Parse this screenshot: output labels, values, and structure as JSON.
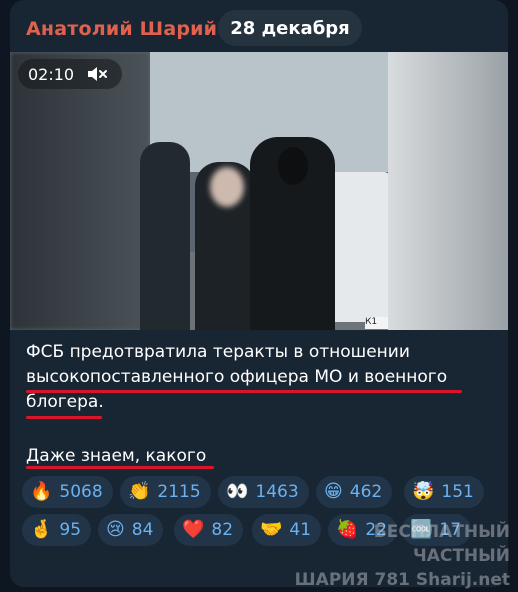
{
  "channel": {
    "author": "Анатолий Шарий",
    "date_label": "28 декабря"
  },
  "video": {
    "duration": "02:10",
    "muted_icon": "speaker-muted-icon",
    "plate_text": "К1"
  },
  "message": {
    "lines": [
      "ФСБ предотвратила теракты в отношении",
      "высокопоставленного офицера МО и военного",
      "блогера.",
      "Даже знаем,  какого"
    ],
    "underline_color": "#d8152b"
  },
  "reactions": [
    {
      "emoji": "🔥",
      "count": "5068"
    },
    {
      "emoji": "👏",
      "count": "2115"
    },
    {
      "emoji": "👀",
      "count": "1463"
    },
    {
      "emoji": "😁",
      "count": "462"
    },
    {
      "emoji": "🤯",
      "count": "151"
    },
    {
      "emoji": "🤞",
      "count": "95"
    },
    {
      "emoji": "😢",
      "count": "84"
    },
    {
      "emoji": "❤️",
      "count": "82"
    },
    {
      "emoji": "🤝",
      "count": "41"
    },
    {
      "emoji": "🍓",
      "count": "22"
    },
    {
      "emoji": "🆒",
      "count": "17"
    }
  ],
  "watermark": {
    "line1": "БЕСПЛАТНЫЙ ЧАСТНЫЙ",
    "line2": "ШАРИЯ 781 Sharij.net"
  },
  "colors": {
    "background": "#0e1621",
    "bubble": "#182533",
    "author": "#e0624e",
    "reaction_text": "#6ab2f2"
  }
}
